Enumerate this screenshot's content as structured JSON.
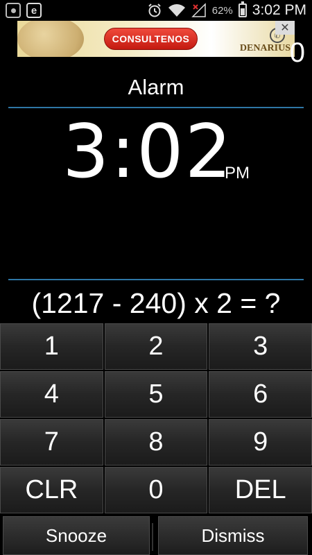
{
  "status_bar": {
    "battery_percent": "62%",
    "time": "3:02 PM",
    "e_icon_label": "e",
    "icons": [
      "photo-notification-icon",
      "e-notification-icon",
      "alarm-clock-icon",
      "wifi-icon",
      "no-signal-icon",
      "battery-icon"
    ]
  },
  "ad": {
    "button_label": "CONSULTENOS",
    "brand": "DENARIUS",
    "close_label": "✕"
  },
  "counter": "0",
  "alarm": {
    "title": "Alarm",
    "time": "3:02",
    "ampm": "PM"
  },
  "challenge": {
    "equation": "(1217 - 240) x 2 = ?"
  },
  "keypad": {
    "keys": [
      "1",
      "2",
      "3",
      "4",
      "5",
      "6",
      "7",
      "8",
      "9",
      "CLR",
      "0",
      "DEL"
    ]
  },
  "actions": {
    "snooze": "Snooze",
    "dismiss": "Dismiss"
  },
  "colors": {
    "divider": "#2e77a6",
    "background": "#000000",
    "ad_button": "#d8261a"
  }
}
